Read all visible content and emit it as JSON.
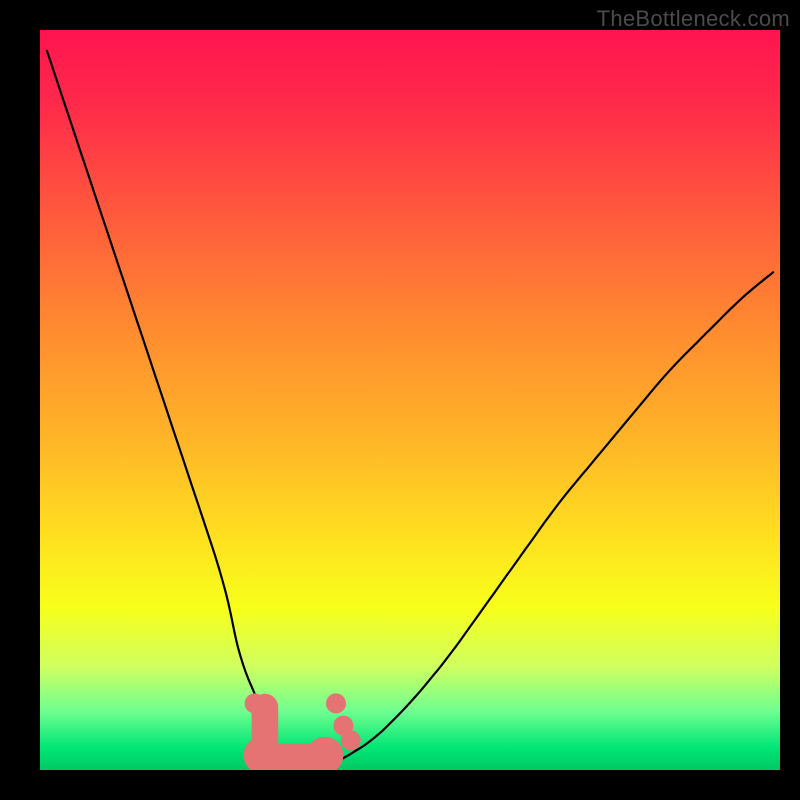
{
  "watermark": "TheBottleneck.com",
  "colors": {
    "background": "#000000",
    "gradient_top": "#ff1450",
    "gradient_mid": "#ffde20",
    "gradient_bottom": "#00c864",
    "curve": "#000000",
    "markers": "#e57373"
  },
  "chart_data": {
    "type": "line",
    "title": "",
    "xlabel": "",
    "ylabel": "",
    "xlim": [
      0,
      100
    ],
    "ylim": [
      0,
      100
    ],
    "x": [
      0,
      5,
      10,
      15,
      20,
      25,
      27,
      30,
      32,
      34,
      36,
      38,
      40,
      45,
      50,
      55,
      60,
      65,
      70,
      75,
      80,
      85,
      90,
      95,
      100
    ],
    "y": [
      100,
      85,
      70,
      55,
      40,
      25,
      15,
      8,
      3,
      1,
      0,
      0,
      1,
      4,
      9,
      15,
      22,
      29,
      36,
      42,
      48,
      54,
      59,
      64,
      68
    ],
    "annotations": [],
    "markers": [
      {
        "x": 29,
        "y": 9
      },
      {
        "x": 40,
        "y": 9
      },
      {
        "x": 41,
        "y": 6
      },
      {
        "x": 42,
        "y": 4
      }
    ],
    "marker_bar": {
      "x_start": 30,
      "x_end": 38.5,
      "y": 1.5,
      "thickness": 4
    }
  }
}
